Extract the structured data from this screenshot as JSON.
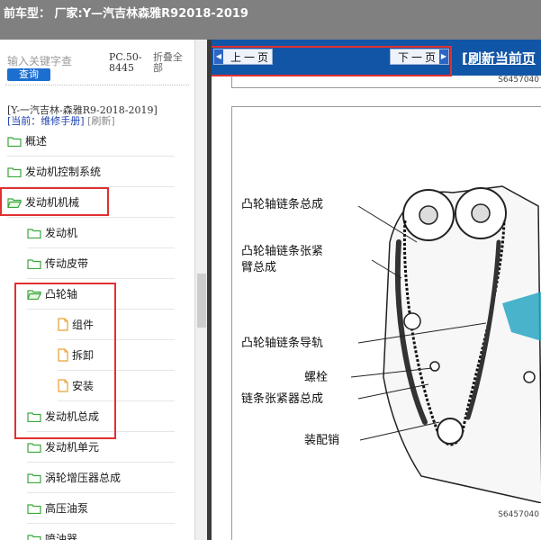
{
  "header": {
    "title": "前车型：   厂家:Y—汽吉林森雅R92018-2019"
  },
  "search": {
    "placeholder": "输入关键字查",
    "query_button": "查询",
    "pc_code": "PC.50-8445",
    "collapse_all": "折叠全部"
  },
  "vehicle_path": "[Y-一汽吉林-森雅R9-2018-2019]",
  "current": {
    "label": "[当前：维修手册]",
    "refresh": "[刷新]"
  },
  "tree": [
    {
      "label": "概述",
      "level": 1,
      "icon": "folder-icon"
    },
    {
      "label": "发动机控制系统",
      "level": 1,
      "icon": "folder-icon"
    },
    {
      "label": "发动机机械",
      "level": 1,
      "icon": "folder-open-icon"
    },
    {
      "label": "发动机",
      "level": 2,
      "icon": "folder-icon"
    },
    {
      "label": "传动皮带",
      "level": 2,
      "icon": "folder-icon"
    },
    {
      "label": "凸轮轴",
      "level": 2,
      "icon": "folder-open-icon"
    },
    {
      "label": "组件",
      "level": 3,
      "icon": "document-icon"
    },
    {
      "label": "拆卸",
      "level": 3,
      "icon": "document-icon"
    },
    {
      "label": "安装",
      "level": 3,
      "icon": "document-icon"
    },
    {
      "label": "发动机总成",
      "level": 2,
      "icon": "folder-icon"
    },
    {
      "label": "发动机单元",
      "level": 2,
      "icon": "folder-icon"
    },
    {
      "label": "涡轮增压器总成",
      "level": 2,
      "icon": "folder-icon"
    },
    {
      "label": "高压油泵",
      "level": 2,
      "icon": "folder-icon"
    },
    {
      "label": "喷油器",
      "level": 2,
      "icon": "folder-icon"
    }
  ],
  "nav": {
    "prev": "上一页",
    "next": "下一页",
    "refresh_page": "[刷新当前页"
  },
  "figure": {
    "code_top": "S6457040",
    "code_bottom": "S6457040",
    "callouts": [
      "凸轮轴链条总成",
      "凸轮轴链条张紧",
      "臂总成",
      "凸轮轴链条导轨",
      "螺栓",
      "链条张紧器总成",
      "装配销"
    ]
  },
  "colors": {
    "accent_red": "#e03030",
    "nav_blue": "#1155a6",
    "folder_green": "#3aa83a",
    "doc_orange": "#e8a030"
  }
}
